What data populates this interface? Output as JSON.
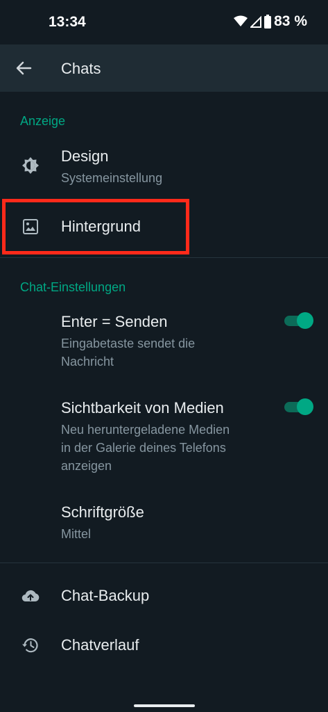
{
  "status_bar": {
    "time": "13:34",
    "battery": "83 %"
  },
  "app_bar": {
    "title": "Chats",
    "back_icon": "arrow-back-icon"
  },
  "sections": {
    "display": {
      "header": "Anzeige",
      "items": [
        {
          "title": "Design",
          "subtitle": "Systemeinstellung",
          "icon": "brightness-icon"
        },
        {
          "title": "Hintergrund",
          "icon": "wallpaper-icon"
        }
      ]
    },
    "chat_settings": {
      "header": "Chat-Einstellungen",
      "items": [
        {
          "title": "Enter = Senden",
          "subtitle_lines": [
            "Eingabetaste sendet die",
            "Nachricht"
          ],
          "toggle": true
        },
        {
          "title": "Sichtbarkeit von Medien",
          "subtitle_lines": [
            "Neu heruntergeladene Medien",
            "in der Galerie deines Telefons",
            "anzeigen"
          ],
          "toggle": true
        },
        {
          "title": "Schriftgröße",
          "subtitle": "Mittel"
        }
      ]
    },
    "other": {
      "items": [
        {
          "title": "Chat-Backup",
          "icon": "cloud-upload-icon"
        },
        {
          "title": "Chatverlauf",
          "icon": "history-icon"
        }
      ]
    }
  },
  "colors": {
    "background": "#121b22",
    "app_bar": "#1f2c34",
    "accent": "#00a884",
    "highlight": "#ff2a1a",
    "secondary_text": "#8696a0"
  }
}
